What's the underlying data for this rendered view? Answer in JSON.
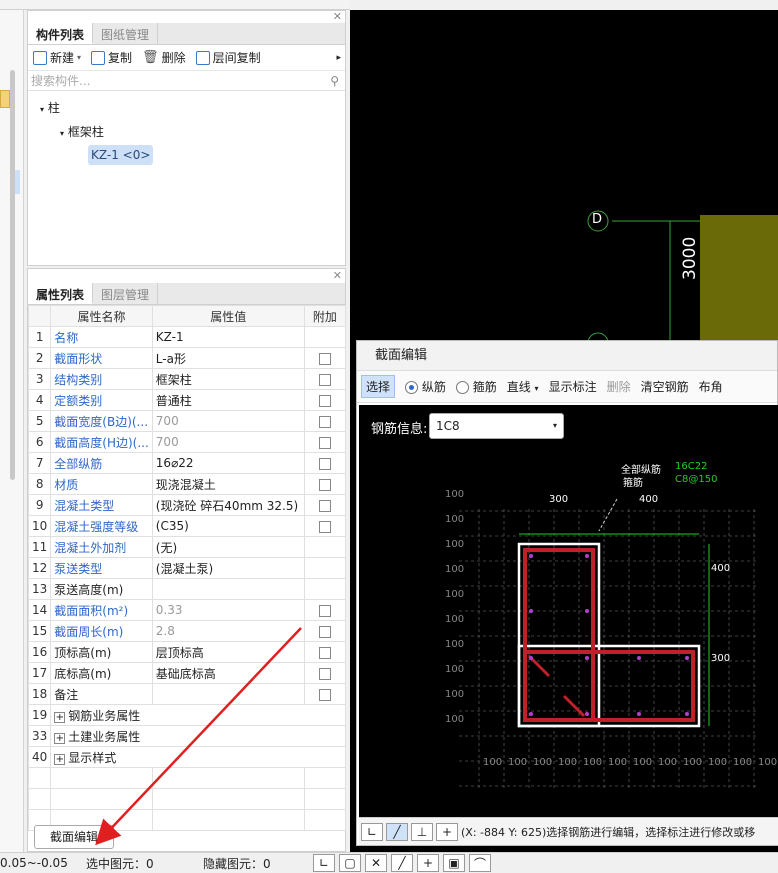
{
  "component_panel": {
    "tabs": [
      "构件列表",
      "图纸管理"
    ],
    "toolbar": {
      "new": "新建",
      "copy": "复制",
      "delete": "删除",
      "floor_copy": "层间复制"
    },
    "search_placeholder": "搜索构件...",
    "tree": {
      "root": "柱",
      "child": "框架柱",
      "leaf": "KZ-1 <0>"
    }
  },
  "property_panel": {
    "tabs": [
      "属性列表",
      "图层管理"
    ],
    "headers": [
      "属性名称",
      "属性值",
      "附加"
    ],
    "rows": [
      {
        "n": "1",
        "name": "名称",
        "value": "KZ-1",
        "blue": true,
        "check": false,
        "gray": false
      },
      {
        "n": "2",
        "name": "截面形状",
        "value": "L-a形",
        "blue": true,
        "check": true,
        "gray": false
      },
      {
        "n": "3",
        "name": "结构类别",
        "value": "框架柱",
        "blue": true,
        "check": true,
        "gray": false
      },
      {
        "n": "4",
        "name": "定额类别",
        "value": "普通柱",
        "blue": true,
        "check": true,
        "gray": false
      },
      {
        "n": "5",
        "name": "截面宽度(B边)(...",
        "value": "700",
        "blue": true,
        "check": true,
        "gray": true
      },
      {
        "n": "6",
        "name": "截面高度(H边)(...",
        "value": "700",
        "blue": true,
        "check": true,
        "gray": true
      },
      {
        "n": "7",
        "name": "全部纵筋",
        "value": "16⌀22",
        "blue": true,
        "check": true,
        "gray": false
      },
      {
        "n": "8",
        "name": "材质",
        "value": "现浇混凝土",
        "blue": true,
        "check": true,
        "gray": false
      },
      {
        "n": "9",
        "name": "混凝土类型",
        "value": "(现浇砼 碎石40mm 32.5)",
        "blue": true,
        "check": true,
        "gray": false
      },
      {
        "n": "10",
        "name": "混凝土强度等级",
        "value": "(C35)",
        "blue": true,
        "check": true,
        "gray": false
      },
      {
        "n": "11",
        "name": "混凝土外加剂",
        "value": "(无)",
        "blue": true,
        "check": false,
        "gray": false
      },
      {
        "n": "12",
        "name": "泵送类型",
        "value": "(混凝土泵)",
        "blue": true,
        "check": false,
        "gray": false
      },
      {
        "n": "13",
        "name": "泵送高度(m)",
        "value": "",
        "blue": false,
        "check": false,
        "gray": false
      },
      {
        "n": "14",
        "name": "截面面积(m²)",
        "value": "0.33",
        "blue": true,
        "check": true,
        "gray": true
      },
      {
        "n": "15",
        "name": "截面周长(m)",
        "value": "2.8",
        "blue": true,
        "check": true,
        "gray": true
      },
      {
        "n": "16",
        "name": "顶标高(m)",
        "value": "层顶标高",
        "blue": false,
        "check": true,
        "gray": false
      },
      {
        "n": "17",
        "name": "底标高(m)",
        "value": "基础底标高",
        "blue": false,
        "check": true,
        "gray": false
      },
      {
        "n": "18",
        "name": "备注",
        "value": "",
        "blue": false,
        "check": true,
        "gray": false
      }
    ],
    "groups": [
      {
        "n": "19",
        "name": "钢筋业务属性"
      },
      {
        "n": "33",
        "name": "土建业务属性"
      },
      {
        "n": "40",
        "name": "显示样式"
      }
    ],
    "edit_button": "截面编辑"
  },
  "canvas": {
    "axis_label": "D",
    "dimension": "3000"
  },
  "section_dialog": {
    "title": "截面编辑",
    "tools": {
      "select": "选择",
      "long_bar": "纵筋",
      "stirrup": "箍筋",
      "line": "直线",
      "show_dim": "显示标注",
      "delete": "删除",
      "clear": "清空钢筋",
      "layout": "布角"
    },
    "rebar_info_label": "钢筋信息:",
    "rebar_info_value": "1C8",
    "labels": {
      "all_long": "全部纵筋",
      "stirrup": "箍筋",
      "long_value": "16C22",
      "stirrup_value": "C8@150"
    },
    "dims": {
      "top_left": "300",
      "top_right": "400",
      "right_top": "400",
      "right_bottom": "300"
    },
    "grid_label": "100",
    "status_text": "(X: -884 Y: 625)选择钢筋进行编辑，选择标注进行修改或移"
  },
  "statusbar": {
    "coord": "0.05~-0.05",
    "selected": "选中图元：0",
    "hidden": "隐藏图元：0"
  },
  "colors": {
    "column_fill": "#6b6a08",
    "rebar": "#c0202a",
    "dimension_green": "#22cc22",
    "arrow": "#e02020"
  }
}
